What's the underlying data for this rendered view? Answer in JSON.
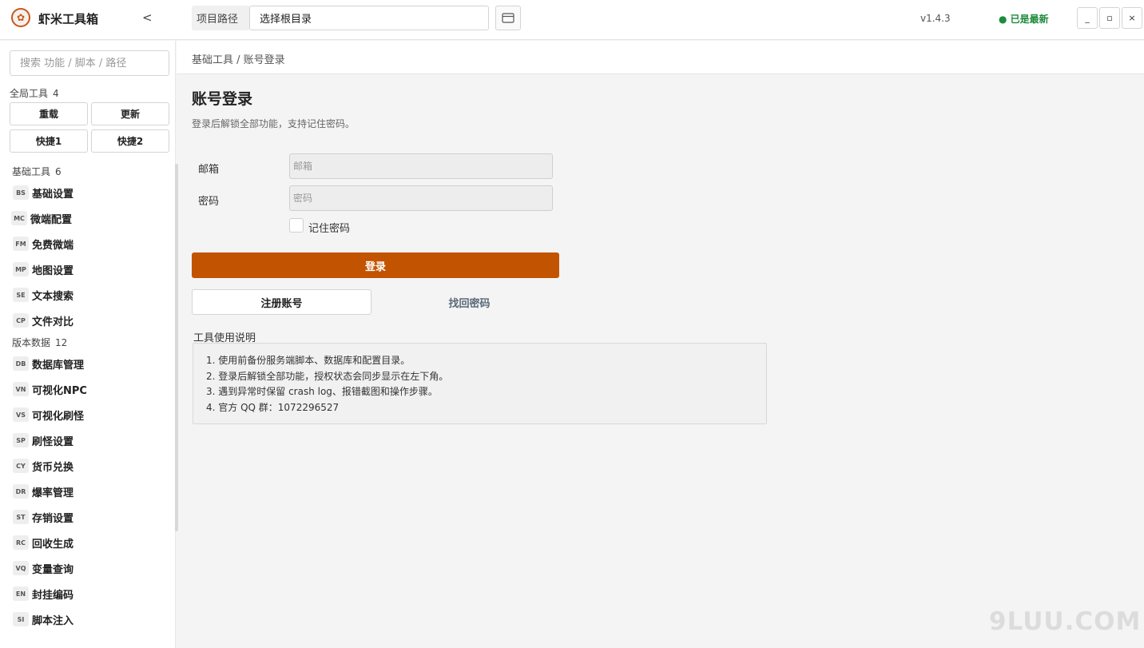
{
  "app": {
    "title": "虾米工具箱",
    "collapse": "<",
    "version": "v1.4.3",
    "status": "● 已是最新"
  },
  "project_path": {
    "label": "项目路径",
    "value": "选择根目录"
  },
  "window": {
    "minimize": "_",
    "maximize": "▫",
    "close": "×"
  },
  "sidebar": {
    "search_placeholder": "搜索 功能 / 脚本 / 路径",
    "global": {
      "title": "全局工具",
      "count": "4",
      "buttons": [
        "重载",
        "更新",
        "快捷1",
        "快捷2"
      ]
    },
    "basic": {
      "title": "基础工具",
      "count": "6",
      "items": [
        {
          "badge": "BS",
          "label": "基础设置"
        },
        {
          "badge": "MC",
          "label": "微端配置"
        },
        {
          "badge": "FM",
          "label": "免费微端"
        },
        {
          "badge": "MP",
          "label": "地图设置"
        },
        {
          "badge": "SE",
          "label": "文本搜索"
        },
        {
          "badge": "CP",
          "label": "文件对比"
        }
      ]
    },
    "version_data": {
      "title": "版本数据",
      "count": "12",
      "items": [
        {
          "badge": "DB",
          "label": "数据库管理"
        },
        {
          "badge": "VN",
          "label": "可视化NPC"
        },
        {
          "badge": "VS",
          "label": "可视化刷怪"
        },
        {
          "badge": "SP",
          "label": "刷怪设置"
        },
        {
          "badge": "CY",
          "label": "货币兑换"
        },
        {
          "badge": "DR",
          "label": "爆率管理"
        },
        {
          "badge": "ST",
          "label": "存销设置"
        },
        {
          "badge": "RC",
          "label": "回收生成"
        },
        {
          "badge": "VQ",
          "label": "变量查询"
        },
        {
          "badge": "EN",
          "label": "封挂编码"
        },
        {
          "badge": "SI",
          "label": "脚本注入"
        }
      ]
    }
  },
  "main": {
    "breadcrumb": "基础工具 / 账号登录",
    "title": "账号登录",
    "subtitle": "登录后解锁全部功能，支持记住密码。",
    "email": {
      "label": "邮箱",
      "placeholder": "邮箱"
    },
    "password": {
      "label": "密码",
      "placeholder": "密码"
    },
    "remember": "记住密码",
    "login": "登录",
    "register": "注册账号",
    "forgot": "找回密码",
    "help": {
      "title": "工具使用说明",
      "lines": [
        "1. 使用前备份服务端脚本、数据库和配置目录。",
        "2. 登录后解锁全部功能，授权状态会同步显示在左下角。",
        "3. 遇到异常时保留 crash log、报错截图和操作步骤。",
        "4. 官方 QQ 群：1072296527"
      ]
    }
  },
  "watermark": "9LUU.COM",
  "colors": {
    "accent": "#c25300",
    "status": "#1f8a3c"
  }
}
